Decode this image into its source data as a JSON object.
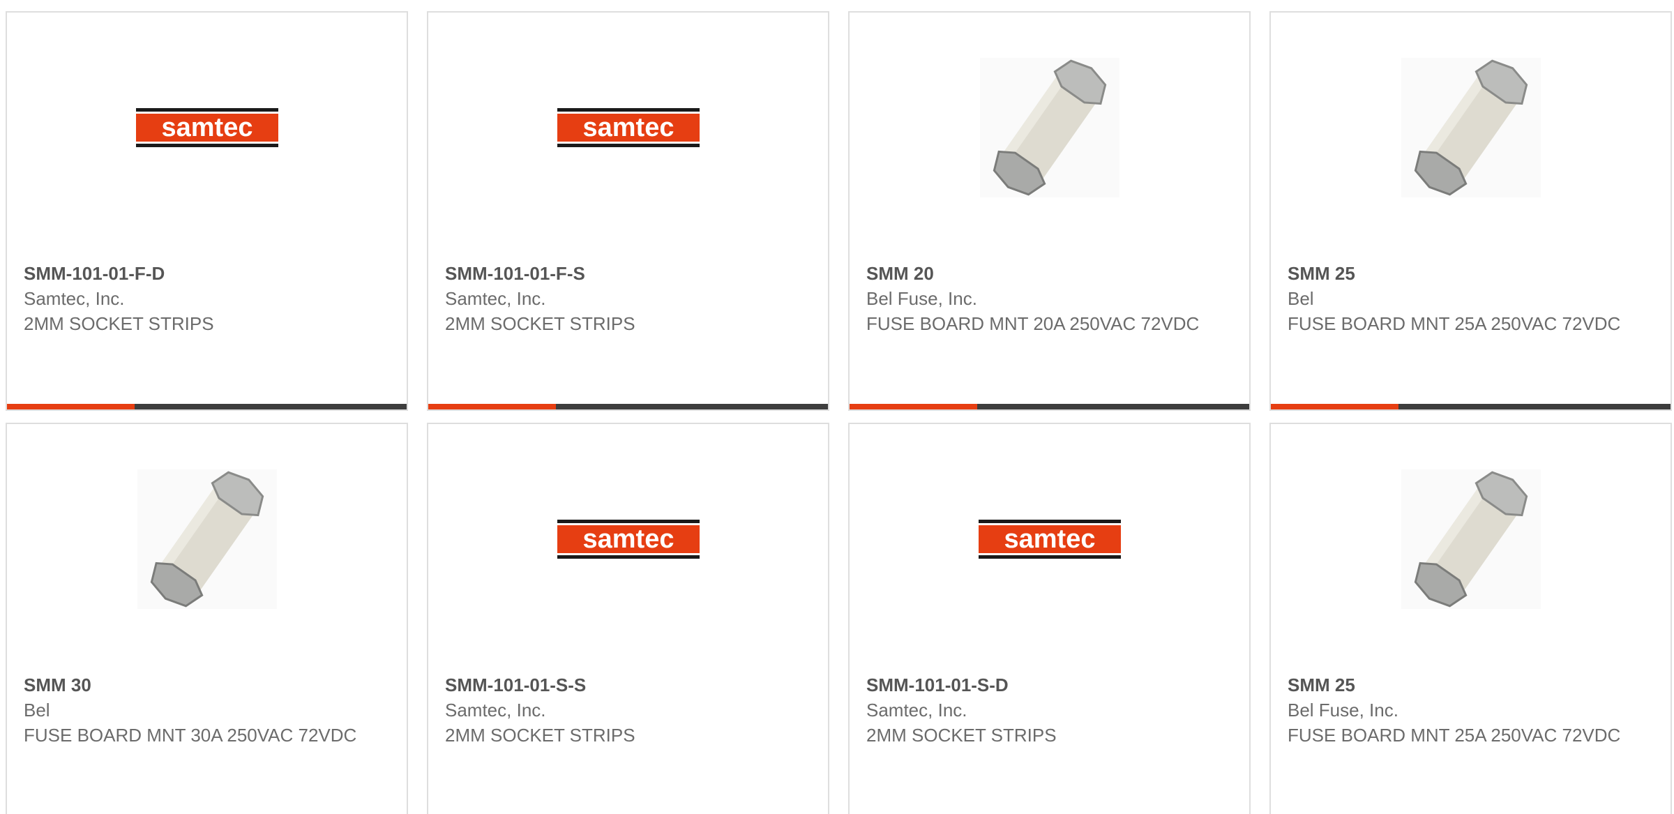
{
  "cards": [
    {
      "part": "SMM-101-01-F-D",
      "maker": "Samtec, Inc.",
      "desc": "2MM SOCKET STRIPS",
      "image": "samtec-logo"
    },
    {
      "part": "SMM-101-01-F-S",
      "maker": "Samtec, Inc.",
      "desc": "2MM SOCKET STRIPS",
      "image": "samtec-logo"
    },
    {
      "part": "SMM 20",
      "maker": "Bel Fuse, Inc.",
      "desc": "FUSE BOARD MNT 20A 250VAC 72VDC",
      "image": "fuse-photo"
    },
    {
      "part": "SMM 25",
      "maker": "Bel",
      "desc": "FUSE BOARD MNT 25A 250VAC 72VDC",
      "image": "fuse-photo"
    },
    {
      "part": "SMM 30",
      "maker": "Bel",
      "desc": "FUSE BOARD MNT 30A 250VAC 72VDC",
      "image": "fuse-photo"
    },
    {
      "part": "SMM-101-01-S-S",
      "maker": "Samtec, Inc.",
      "desc": "2MM SOCKET STRIPS",
      "image": "samtec-logo"
    },
    {
      "part": "SMM-101-01-S-D",
      "maker": "Samtec, Inc.",
      "desc": "2MM SOCKET STRIPS",
      "image": "samtec-logo"
    },
    {
      "part": "SMM 25",
      "maker": "Bel Fuse, Inc.",
      "desc": "FUSE BOARD MNT 25A 250VAC 72VDC",
      "image": "fuse-photo"
    }
  ],
  "logo_text": "samtec",
  "colors": {
    "accent": "#e63e12",
    "bar": "#3d3d3d",
    "border": "#dedede",
    "text": "#6b6b6b"
  }
}
